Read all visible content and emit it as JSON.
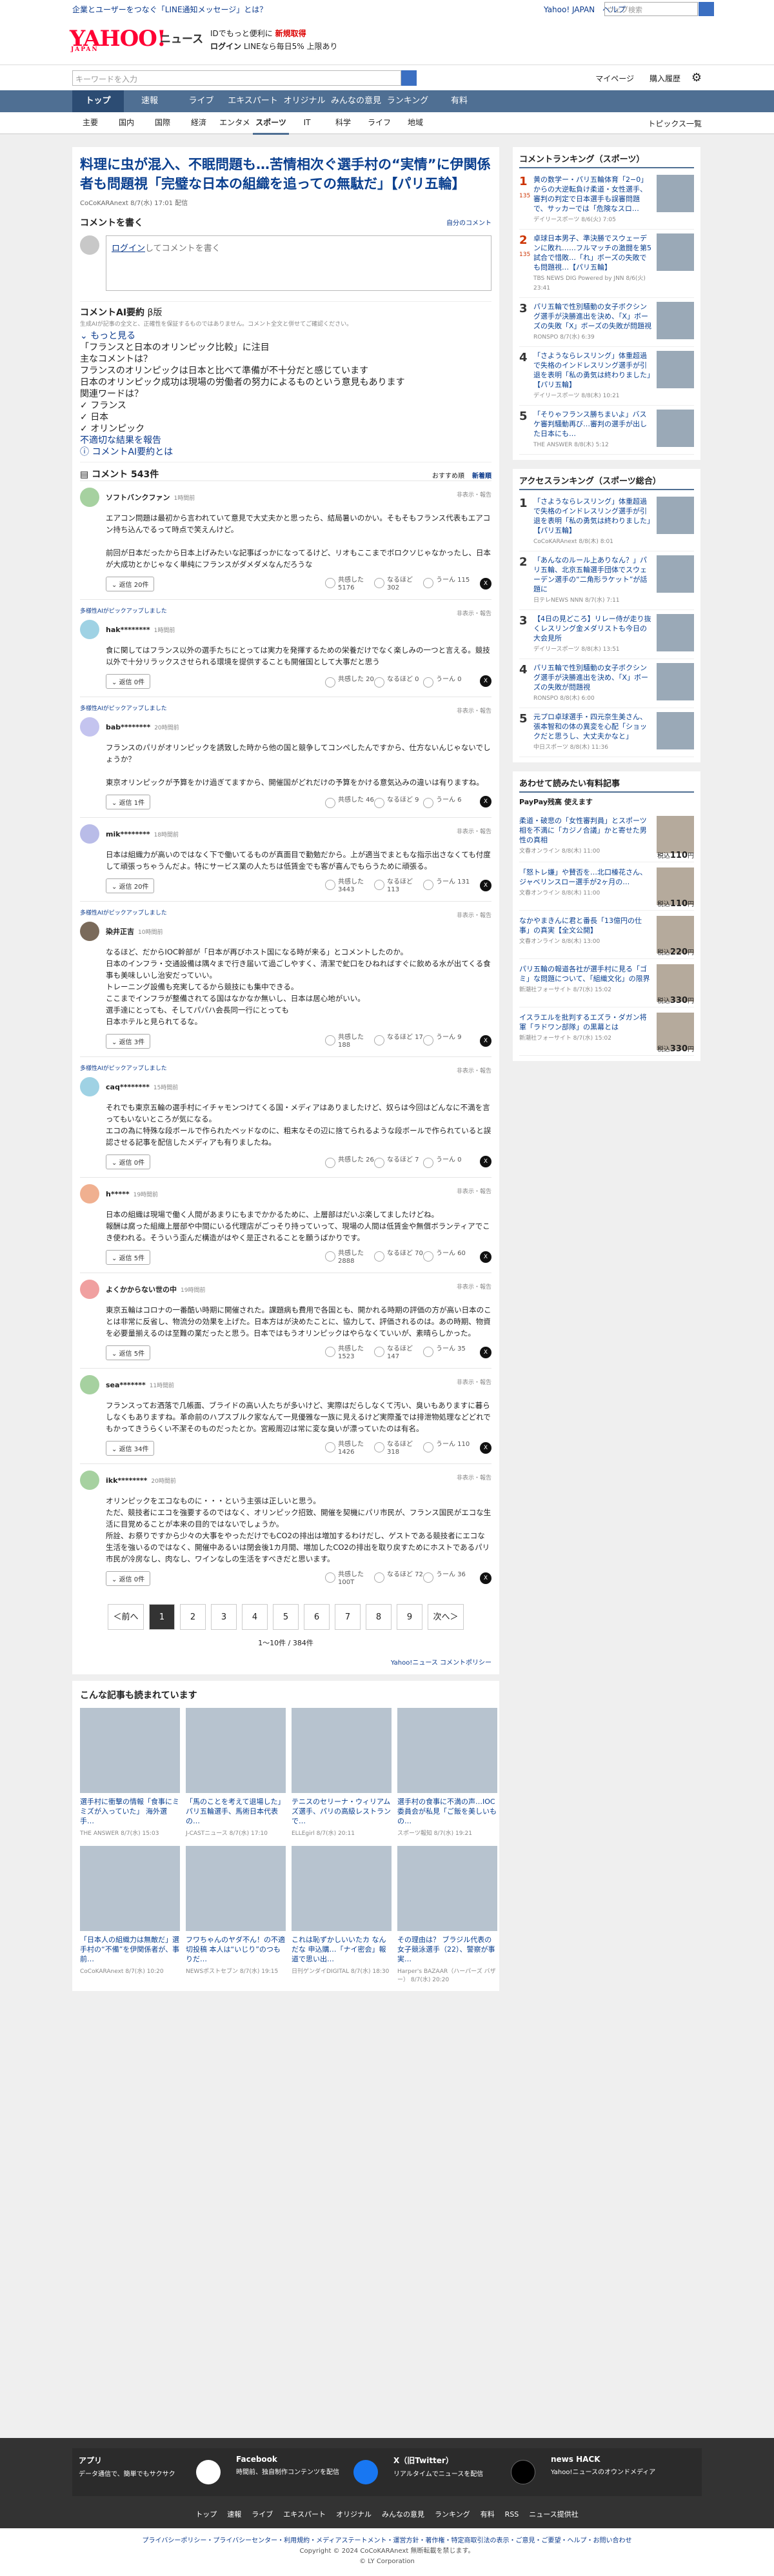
{
  "header": {
    "promo": "企業とユーザーをつなぐ「LINE通知メッセージ」とは？",
    "links": [
      "Yahoo! JAPAN",
      "ヘルプ"
    ],
    "websearch": "ウェブ検索",
    "logo": "YAHOO!",
    "logo_sub": "JAPAN",
    "news": "ニュース",
    "hp1a": "IDでもっと便利に",
    "hp1b": "新規取得",
    "hp2a": "ログイン",
    "hp2b": "LINEなら毎日5% 上限あり",
    "search_ph": "キーワードを入力",
    "mypage": "マイページ",
    "buy": "購入履歴"
  },
  "nav1": [
    "トップ",
    "速報",
    "ライブ",
    "エキスパート",
    "オリジナル",
    "みんなの意見",
    "ランキング",
    "有料"
  ],
  "nav2": [
    "主要",
    "国内",
    "国際",
    "経済",
    "エンタメ",
    "スポーツ",
    "IT",
    "科学",
    "ライフ",
    "地域"
  ],
  "nav2_right": "トピックス一覧",
  "article": {
    "title": "料理に虫が混入、不眠問題も…苦情相次ぐ選手村の“実情”に伊関係者も問題視「完璧な日本の組織を追っての無駄だ」【パリ五輪】",
    "meta": "CoCoKARAnext 8/7(水) 17:01 配信"
  },
  "comment_form": {
    "head": "コメントを書く",
    "rules": "自分のコメント",
    "login": "ログイン",
    "placeholder": "してコメントを書く"
  },
  "ai": {
    "head": "コメントAI要約",
    "beta": "β版",
    "note": "生成AIが記事の全文と、正確性を保証するものではありません。コメント全文と併せてご確認ください。",
    "more": "もっと見る",
    "l1": "「フランスと日本のオリンピック比較」に注目",
    "l2": "主なコメントは？",
    "l3": "フランスのオリンピックは日本と比べて準備が不十分だと感じています",
    "l4": "日本のオリンピック成功は現場の労働者の努力によるものという意見もあります",
    "l5": "関連ワードは？",
    "w1": "フランス",
    "w2": "日本",
    "w3": "オリンピック",
    "report": "不適切な結果を報告",
    "about": "コメントAI要約とは"
  },
  "comments_head": {
    "title": "コメント 543件",
    "tab1": "おすすめ順",
    "tab2": "新着順"
  },
  "comments": [
    {
      "badge": "",
      "user": "ソフトバンクファン",
      "time": "1時間前",
      "report": "非表示・報告",
      "body": "エアコン問題は最初から言われていて意見で大丈夫かと思ったら、結局暑いのかい。そもそもフランス代表もエアコン持ち込んでるって時点で笑えんけど。\n\n前回が日本だったから日本上げみたいな記事ばっかになってるけど、リオもここまでボロクソじゃなかったし、日本が大成功とかじゃなく単純にフランスがダメダメなんだろうな",
      "replies": "返信 20件",
      "r1": "共感した 5176",
      "r2": "なるほど 302",
      "r3": "うーん 115",
      "color": "#a6d1a0"
    },
    {
      "badge": "多様性AIがピックアップしました",
      "user": "hak********",
      "time": "1時間前",
      "report": "非表示・報告",
      "body": "食に関してはフランス以外の選手たちにとっては実力を発揮するための栄養だけでなく楽しみの一つと言える。競技以外で十分リラックスさせられる環境を提供することも開催国として大事だと思う",
      "replies": "返信 0件",
      "r1": "共感した 20",
      "r2": "なるほど 0",
      "r3": "うーん 0",
      "color": "#9fd2e4"
    },
    {
      "badge": "多様性AIがピックアップしました",
      "user": "bab********",
      "time": "20時間前",
      "report": "非表示・報告",
      "body": "フランスのパリがオリンピックを誘致した時から他の国と競争してコンペしたんですから、仕方ないんじゃないでしょうか？\n\n東京オリンピックが予算をかけ過ぎてますから、開催国がどれだけの予算をかける意気込みの違いは有りますね。",
      "replies": "返信 1件",
      "r1": "共感した 46",
      "r2": "なるほど 9",
      "r3": "うーん 6",
      "color": "#c4c4ef"
    },
    {
      "badge": "",
      "user": "mik********",
      "time": "18時間前",
      "report": "非表示・報告",
      "body": "日本は組織力が高いのではなく下で働いてるものが真面目で勤勉だから。上が適当でまともな指示出さなくても付度して頑張っちゃうんだよ。特にサービス業の人たちは低賃金でも客が喜んでもらうために頑張る。",
      "replies": "返信 20件",
      "r1": "共感した 3443",
      "r2": "なるほど 113",
      "r3": "うーん 131",
      "color": "#b9bce8"
    },
    {
      "badge": "多様性AIがピックアップしました",
      "user": "染井正吉",
      "time": "10時間前",
      "report": "非表示・報告",
      "body": "なるほど、だからIOC幹部が「日本が再びホスト国になる時が来る」とコメントしたのか。\n日本のインフラ・交通設備は隅々まで行き届いて過ごしやすく、清潔で虻口をひねればすぐに飲める水が出てくる食事も美味しいし治安だっていい。\nトレーニング設備も充実してるから競技にも集中できる。\nここまでインフラが整備されてる国はなかなか無いし、日本は居心地がいい。\n選手達にとっても、そしてパパハ会長同一行にとっても\n日本ホテルと見られてるな。",
      "replies": "返信 3件",
      "r1": "共感した 188",
      "r2": "なるほど 17",
      "r3": "うーん 9",
      "color": "#7a6a5a"
    },
    {
      "badge": "多様性AIがピックアップしました",
      "user": "caq********",
      "time": "15時間前",
      "report": "非表示・報告",
      "body": "それでも東京五輪の選手村にイチャモンつけてくる国・メディアはありましたけど、奴らは今回はどんなに不満を言ってもいないところが気になる。\nエコの為に特殊な段ボールで作られたベッドなのに、粗末なその辺に捨てられるような段ボールで作られていると誤認させる記事を配信したメディアも有りましたね。",
      "replies": "返信 0件",
      "r1": "共感した 26",
      "r2": "なるほど 7",
      "r3": "うーん 0",
      "color": "#9fd2e4"
    },
    {
      "badge": "",
      "user": "h*****",
      "time": "19時間前",
      "report": "非表示・報告",
      "body": "日本の組織は現場で働く人間があまりにもまでかかるために、上層部はだいぶ楽してましたけどね。\n報酬は腐った組織上層部や中間にいる代理店がごっそり持っていって、現場の人間は低賃金や無償ボランティアでこき使われる。そういう歪んだ構造がはやく是正されることを願うばかりです。",
      "replies": "返信 5件",
      "r1": "共感した 2888",
      "r2": "なるほど 70",
      "r3": "うーん 60",
      "color": "#f0b090"
    },
    {
      "badge": "",
      "user": "よくかからない世の中",
      "time": "19時間前",
      "report": "非表示・報告",
      "body": "東京五輪はコロナの一番酷い時期に開催された。課題病も費用で各国とも、開かれる時期の評価の方が高い日本のことは非常に反省し、物流分の効果を上げた。日本方はが決めたことに、協力して、評価されるのは。あの時期、物資を必要量揃えるのは至難の業だったと思う。日本ではもうオリンピックはやらなくていいが、素晴らしかった。",
      "replies": "返信 5件",
      "r1": "共感した 1523",
      "r2": "なるほど 147",
      "r3": "うーん 35",
      "color": "#f0a0a0"
    },
    {
      "badge": "",
      "user": "sea*******",
      "time": "11時間前",
      "report": "非表示・報告",
      "body": "フランスってお洒落で几帳面、ブライドの高い人たちが多いけど、実際はだらしなくて汚い、臭いもありますに暮らしなくもありますね。革命前のハプスブルク家なんて一見優雅な一族に見えるけど実際蚤では排泄物処理などどれでもかってきうらくい不潔そのものだったとか。宮殿周辺は常に変な臭いが漂っていたのは有名。",
      "replies": "返信 34件",
      "r1": "共感した 1426",
      "r2": "なるほど 318",
      "r3": "うーん 110",
      "color": "#a6d1a0"
    },
    {
      "badge": "",
      "user": "ikk********",
      "time": "20時間前",
      "report": "非表示・報告",
      "body": "オリンピックをエコなものに・・・という主張は正しいと思う。\nただ、競技者にエコを強要するのではなく、オリンピック招致、開催を契機にパリ市民が、フランス国民がエコな生活に目覚めることが本来の目的ではないでしょうか。\n所詮、お祭りですから少々の大事をやっただけでもCO2の排出は増加するわけだし、ゲストである競技者にエコな生活を強いるのではなく、開催中あるいは閉会後1カ月間、増加したCO2の排出を取り戻すためにホストであるパリ市民が冷房なし、肉なし、ワインなしの生活をすべきだと思います。",
      "replies": "返信 0件",
      "r1": "共感した 100T",
      "r2": "なるほど 72",
      "r3": "うーん 36",
      "color": "#a6d1a0"
    }
  ],
  "pager": {
    "prev": "＜前へ",
    "pages": [
      "1",
      "2",
      "3",
      "4",
      "5",
      "6",
      "7",
      "8",
      "9"
    ],
    "next": "次へ＞",
    "count": "1〜10件 / 384件",
    "policy": "Yahoo!ニュース コメントポリシー"
  },
  "recommended": {
    "title": "こんな記事も読まれています",
    "items": [
      {
        "t": "選手村に衝撃の情報「食事にミミズが入っていた」 海外選手…",
        "s": "THE ANSWER 8/7(水) 15:03"
      },
      {
        "t": "「馬のことを考えて退場した」パリ五輪選手、馬術日本代表の…",
        "s": "J-CASTニュース 8/7(水) 17:10"
      },
      {
        "t": "テニスのセリーナ・ウィリアムズ選手、パリの高級レストランで…",
        "s": "ELLEgirl 8/7(水) 20:11"
      },
      {
        "t": "選手村の食事に不満の声…IOC委員会が私見「ご飯を美しいもの…",
        "s": "スポーツ報知 8/7(水) 19:21"
      },
      {
        "t": "「日本人の組織力は無敵だ」選手村の“不備”を伊関係者が、事前…",
        "s": "CoCoKARAnext 8/7(水) 10:20"
      },
      {
        "t": "フワちゃんのヤダ不ん！の不適切投稿 本人は“いじり”のつもりだ…",
        "s": "NEWSポストセブン 8/7(水) 19:15"
      },
      {
        "t": "これは恥ずかしいいたカ なんだな 申込購…「ナイ密会」報道で思い出…",
        "s": "日刊ゲンダイDIGITAL 8/7(水) 18:30"
      },
      {
        "t": "その理由は？ ブラジル代表の女子競泳選手（22）、警察が事実…",
        "s": "Harper's BAZAAR（ハーパーズ バザー） 8/7(水) 20:20"
      }
    ]
  },
  "side": {
    "rank_title": "コメントランキング（スポーツ）",
    "rank": [
      {
        "n": "1",
        "c": "135",
        "t": "黄の数学ー・パリ五輪体育「2−0」からの大逆転負け柔道・女性選手、審判の判定で日本選手も誤審問題で、サッカーでは「危険なスロ…",
        "s": "デイリースポーツ 8/6(火) 7:05"
      },
      {
        "n": "2",
        "c": "135",
        "t": "卓球日本男子、準決勝でスウェーデンに敗れ……フルマッチの激闘を第5試合で惜敗…「れ」ボーズの失敗でも問題視…【パリ五輪】",
        "s": "TBS NEWS DIG Powered by JNN 8/6(火) 23:41"
      },
      {
        "n": "3",
        "c": "",
        "t": "パリ五輪で性別騒動の女子ボクシング選手が決勝進出を決め、「X」ボーズの失敗「X」ボーズの失敗が問題視",
        "s": "RONSPO 8/7(水) 6:39"
      },
      {
        "n": "4",
        "c": "",
        "t": "「さようならレスリング」体重超過で失格のインドレスリング選手が引退を表明「私の勇気は終わりました」【パリ五輪】",
        "s": "デイリースポーツ 8/8(木) 10:21"
      },
      {
        "n": "5",
        "c": "",
        "t": "「そりゃフランス勝ちまいよ」バスケ審判騒動再び…審判の選手が出した日本にも…",
        "s": "THE ANSWER 8/8(木) 5:12"
      }
    ],
    "access_title": "アクセスランキング（スポーツ総合）",
    "access": [
      {
        "n": "1",
        "t": "「さようならレスリング」体重超過で失格のインドレスリング選手が引退を表明「私の勇気は終わりました」【パリ五輪】",
        "s": "CoCoKARAnext 8/8(木) 8:01"
      },
      {
        "n": "2",
        "t": "「あんなのルール上ありなん？」パリ五輪、北京五輪選手団体でスウェーデン選手の“二角形ラケット”が話題に",
        "s": "日テレNEWS NNN 8/7(水) 7:11"
      },
      {
        "n": "3",
        "t": "【4日の見どころ】リレー侍が走り抜くレスリング金メダリストも今日の大会見所",
        "s": "デイリースポーツ 8/8(木) 13:51"
      },
      {
        "n": "4",
        "t": "パリ五輪で性別騒動の女子ボクシング選手が決勝進出を決め、「X」ボーズの失敗が問題視",
        "s": "RONSPO 8/8(木) 6:00"
      },
      {
        "n": "5",
        "t": "元プロ卓球選手・四元奈生美さん、張本智和の体の異変を心配「ショックだと思うし、大丈夫かなと」",
        "s": "中日スポーツ 8/8(木) 11:36"
      }
    ],
    "paid_title": "あわせて読みたい有料記事",
    "paypay": "PayPay残高 使えます",
    "paid": [
      {
        "t": "柔道・破悲の「女性審判員」とスポーツ相を不満に「カジノ合議」かと寄せた男性の真相",
        "s": "文春オンライン 8/8(木) 11:00",
        "p": "110"
      },
      {
        "t": "「怒トレ嫌」や賛否を…北口榛花さん、ジャベリンスロー選手が2ヶ月の…",
        "s": "文春オンライン 8/8(木) 11:00",
        "p": "110"
      },
      {
        "t": "なかやまきんに君と番長「13億円の仕事」の真実【全文公開】",
        "s": "文春オンライン 8/8(木) 13:00",
        "p": "220"
      },
      {
        "t": "パリ五輪の報道各社が選手村に見る「ゴミ」な問題について、「組織文化」の限界",
        "s": "新潮社フォーサイト 8/7(水) 15:02",
        "p": "330"
      },
      {
        "t": "イスラエルを批判するエズラ・ダガン将軍「ラドワン部隊」の黒幕とは",
        "s": "新潮社フォーサイト 8/7(水) 15:02",
        "p": "330"
      }
    ]
  },
  "footer": {
    "app": "アプリ",
    "app_d": "データ通信で、簡単でもサクサク",
    "fb": "Facebook",
    "fb_d": "時間前、独自制作コンテンツを配信",
    "x": "X（旧Twitter）",
    "x_d": "リアルタイムでニュースを配信",
    "hack": "news HACK",
    "hack_d": "Yahoo!ニュースのオウンドメディア",
    "links": [
      "トップ",
      "速報",
      "ライブ",
      "エキスパート",
      "オリジナル",
      "みんなの意見",
      "ランキング",
      "有料",
      "RSS",
      "ニュース提供社"
    ],
    "b1": "プライバシーポリシー・プライバシーセンター・利用規約・メディアステートメント・運営方針・著作権・特定商取引法の表示・ご意見・ご要望・ヘルプ・お問い合わせ",
    "b2": "Copyright © 2024 CoCoKARAnext 無断転載を禁じます。",
    "b3": "© LY Corporation"
  },
  "colors": {
    "brand": "#ff0033",
    "nav": "#4f6f93",
    "link": "#0a3f8f"
  }
}
